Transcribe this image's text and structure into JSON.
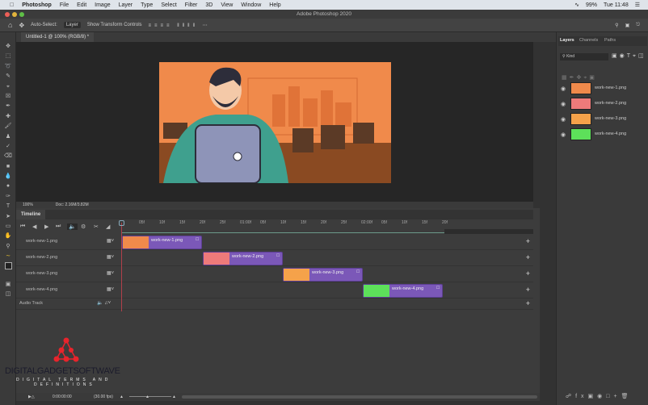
{
  "menubar": {
    "app": "Photoshop",
    "items": [
      "File",
      "Edit",
      "Image",
      "Layer",
      "Type",
      "Select",
      "Filter",
      "3D",
      "View",
      "Window",
      "Help"
    ],
    "battery": "99%",
    "clock": "Tue 11:48"
  },
  "window": {
    "title": "Adobe Photoshop 2020"
  },
  "options": {
    "auto_select": "Auto-Select:",
    "layer_dropdown": "Layer",
    "show_transform": "Show Transform Controls"
  },
  "document": {
    "tab": "Untitled-1 @ 100% (RGB/8) *",
    "zoom": "100%",
    "doc_size": "Doc: 2.16M/3.82M"
  },
  "timeline": {
    "title": "Timeline",
    "ruler": [
      "05f",
      "10f",
      "15f",
      "20f",
      "25f",
      "01:00f",
      "05f",
      "10f",
      "15f",
      "20f",
      "25f",
      "02:00f",
      "05f",
      "10f",
      "15f",
      "20f"
    ],
    "tracks": [
      {
        "name": "work-new-1.png"
      },
      {
        "name": "work-new-2.png"
      },
      {
        "name": "work-new-3.png"
      },
      {
        "name": "work-new-4.png"
      }
    ],
    "clips": [
      {
        "name": "work-new-1.png",
        "thumb": "#f08a4b"
      },
      {
        "name": "work-new-2.png",
        "thumb": "#ee7a7a"
      },
      {
        "name": "work-new-3.png",
        "thumb": "#f5a24a"
      },
      {
        "name": "work-new-4.png",
        "thumb": "#5de05a"
      }
    ],
    "audio_track": "Audio Track",
    "timecode": "0:00:00:00",
    "fps": "(30.00 fps)",
    "clip_color": "#7b58b8"
  },
  "layers_panel": {
    "tabs": [
      "Layers",
      "Channels",
      "Paths"
    ],
    "filter": "Kind",
    "layers": [
      {
        "name": "work-new-1.png",
        "thumb": "#f08a4b"
      },
      {
        "name": "work-new-2.png",
        "thumb": "#ee7a7a"
      },
      {
        "name": "work-new-3.png",
        "thumb": "#f5a24a"
      },
      {
        "name": "work-new-4.png",
        "thumb": "#5de05a"
      }
    ]
  },
  "watermark": {
    "brand": "DIGITALGADGETSOFTWAVE",
    "tagline1": "DIGITAL TERMS AND",
    "tagline2": "DEFINITIONS"
  }
}
